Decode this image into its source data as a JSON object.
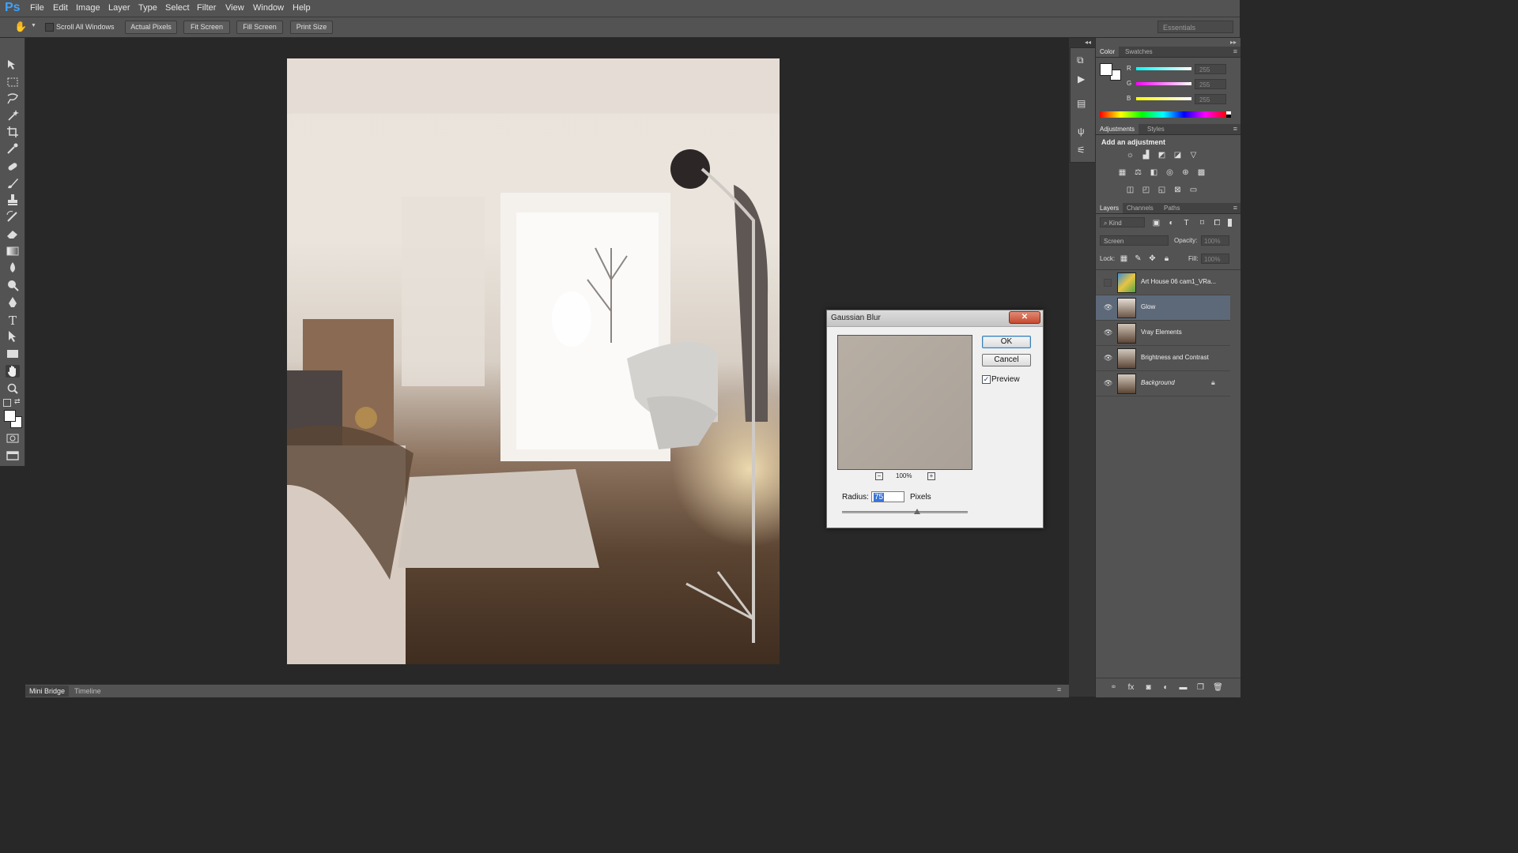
{
  "app": {
    "logo": "Ps"
  },
  "menu": [
    "File",
    "Edit",
    "Image",
    "Layer",
    "Type",
    "Select",
    "Filter",
    "View",
    "Window",
    "Help"
  ],
  "options_bar": {
    "scroll_all_windows": "Scroll All Windows",
    "scroll_all_checked": false,
    "buttons": [
      "Actual Pixels",
      "Fit Screen",
      "Fill Screen",
      "Print Size"
    ],
    "workspace": "Essentials"
  },
  "toolbar": {
    "tools": [
      "move-icon",
      "marquee-icon",
      "lasso-icon",
      "magic-wand-icon",
      "crop-icon",
      "eyedropper-icon",
      "healing-brush-icon",
      "brush-icon",
      "clone-stamp-icon",
      "history-brush-icon",
      "eraser-icon",
      "gradient-icon",
      "blur-icon",
      "dodge-icon",
      "pen-icon",
      "type-icon",
      "path-selection-icon",
      "shape-icon",
      "hand-icon",
      "zoom-icon"
    ],
    "active_tool": "hand-icon"
  },
  "bottom_tabs": [
    "Mini Bridge",
    "Timeline"
  ],
  "color_panel": {
    "tabs": [
      "Color",
      "Swatches"
    ],
    "channels": [
      {
        "label": "R",
        "value": "255"
      },
      {
        "label": "G",
        "value": "255"
      },
      {
        "label": "B",
        "value": "255"
      }
    ]
  },
  "adjustments_panel": {
    "tabs": [
      "Adjustments",
      "Styles"
    ],
    "heading": "Add an adjustment"
  },
  "layers_panel": {
    "tabs": [
      "Layers",
      "Channels",
      "Paths"
    ],
    "filter_kind": "Kind",
    "blend_mode": "Screen",
    "opacity_label": "Opacity:",
    "opacity_value": "100%",
    "lock_label": "Lock:",
    "fill_label": "Fill:",
    "fill_value": "100%",
    "layers": [
      {
        "name": "Art House 06 cam1_VRa...",
        "visible": false,
        "selected": false
      },
      {
        "name": "Glow",
        "visible": true,
        "selected": true
      },
      {
        "name": "Vray Elements",
        "visible": true,
        "selected": false
      },
      {
        "name": "Brightness and Contrast",
        "visible": true,
        "selected": false
      },
      {
        "name": "Background",
        "visible": true,
        "selected": false,
        "locked": true
      }
    ]
  },
  "dialog": {
    "title": "Gaussian Blur",
    "close": "✕",
    "ok": "OK",
    "cancel": "Cancel",
    "preview_label": "Preview",
    "preview_checked": true,
    "zoom": "100%",
    "radius_label": "Radius:",
    "radius_value": "75",
    "radius_unit": "Pixels",
    "slider_position": 0.6
  }
}
